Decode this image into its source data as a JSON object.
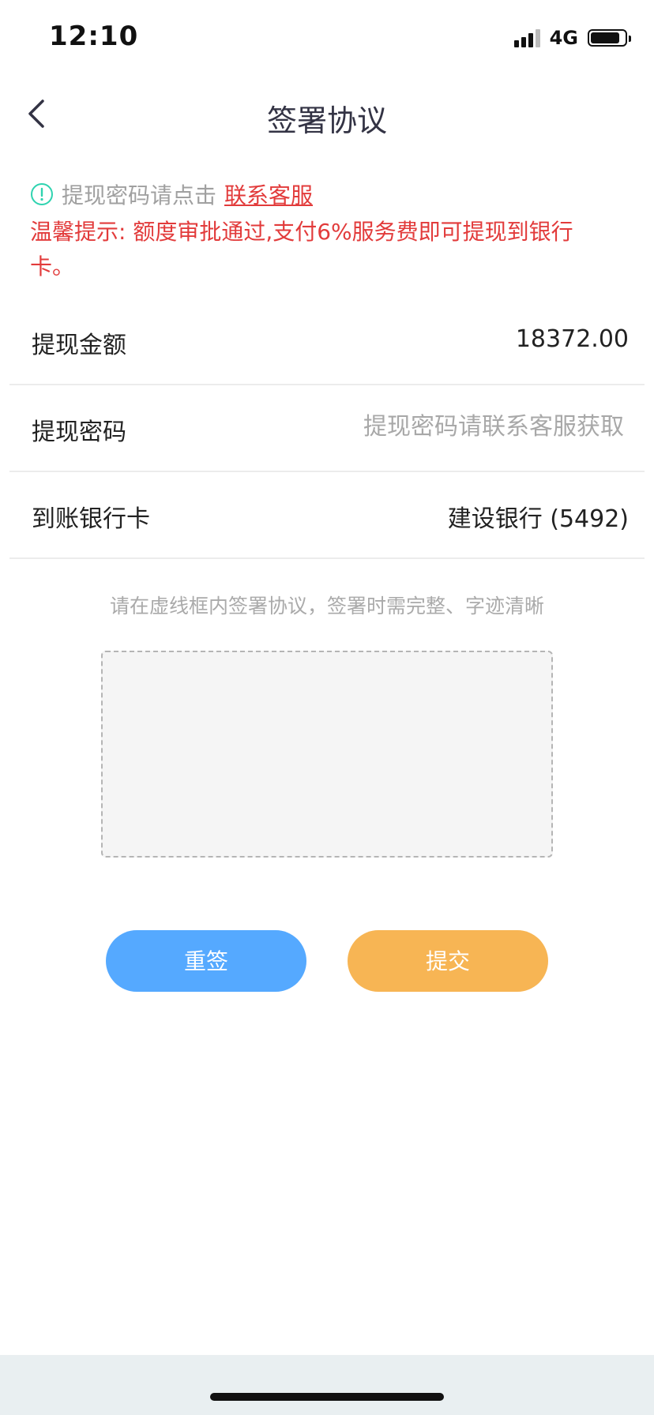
{
  "status_bar": {
    "time": "12:10",
    "network": "4G",
    "signal_icon": "signal-bars-icon",
    "battery_icon": "battery-icon",
    "battery_level": 0.85
  },
  "nav": {
    "back_icon": "chevron-left-icon",
    "title": "签署协议"
  },
  "notice": {
    "icon": "info-circle-icon",
    "icon_color": "#2fd3b0",
    "prefix": "提现密码请点击",
    "link": "联系客服",
    "tip": "温馨提示: 额度审批通过,支付6%服务费即可提现到银行卡。",
    "tip_color": "#e23b3b"
  },
  "form": {
    "amount": {
      "label": "提现金额",
      "value": "18372.00"
    },
    "password": {
      "label": "提现密码",
      "value": "",
      "placeholder": "提现密码请联系客服获取"
    },
    "bank": {
      "label": "到账银行卡",
      "value": "建设银行 (5492)"
    }
  },
  "signature": {
    "hint": "请在虚线框内签署协议，签署时需完整、字迹清晰"
  },
  "buttons": {
    "resign": "重签",
    "submit": "提交",
    "resign_color": "#55a9ff",
    "submit_color": "#f7b554"
  }
}
